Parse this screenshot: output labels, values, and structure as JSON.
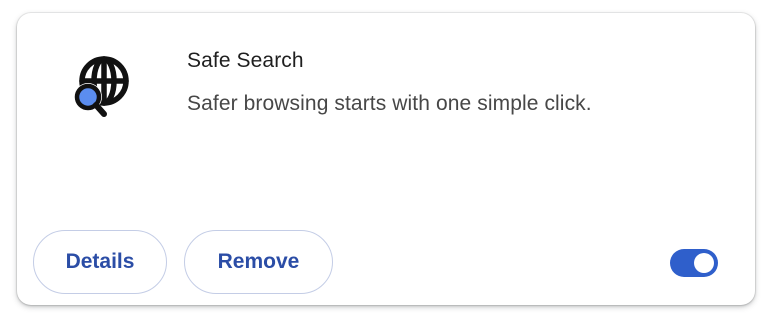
{
  "extension": {
    "name": "Safe Search",
    "description": "Safer browsing starts with one simple click.",
    "icon": "globe-magnifier-icon"
  },
  "actions": {
    "details_label": "Details",
    "remove_label": "Remove"
  },
  "toggle": {
    "enabled": true
  },
  "colors": {
    "accent": "#2f5fcb",
    "button_text": "#2b4da6",
    "button_border": "#c4cde6",
    "icon_blue": "#5b8def",
    "icon_dark": "#111111"
  }
}
